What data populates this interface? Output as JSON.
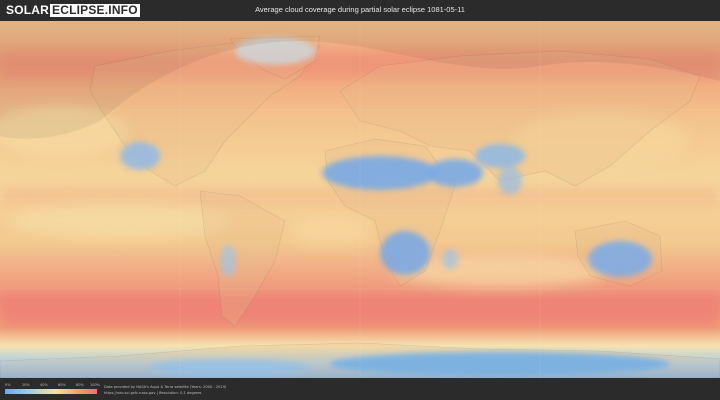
{
  "header": {
    "logo_text_left": "SOLAR",
    "logo_text_right": "ECLIPSE.INFO",
    "title": "Average cloud coverage during partial solar eclipse 1081-05-11"
  },
  "legend": {
    "ticks": [
      "0%",
      "20%",
      "40%",
      "60%",
      "80%",
      "100%"
    ],
    "color_low": "#6fa9e6",
    "color_mid": "#f1e6a0",
    "color_high": "#ef6f6f"
  },
  "footer": {
    "credit_line1": "Data provided by NASA's Aqua & Terra satellite (Years: 2000 - 2019)",
    "credit_line2": "https://neo.sci.gsfc.nasa.gov  |  Resolution: 0.1 degrees"
  }
}
